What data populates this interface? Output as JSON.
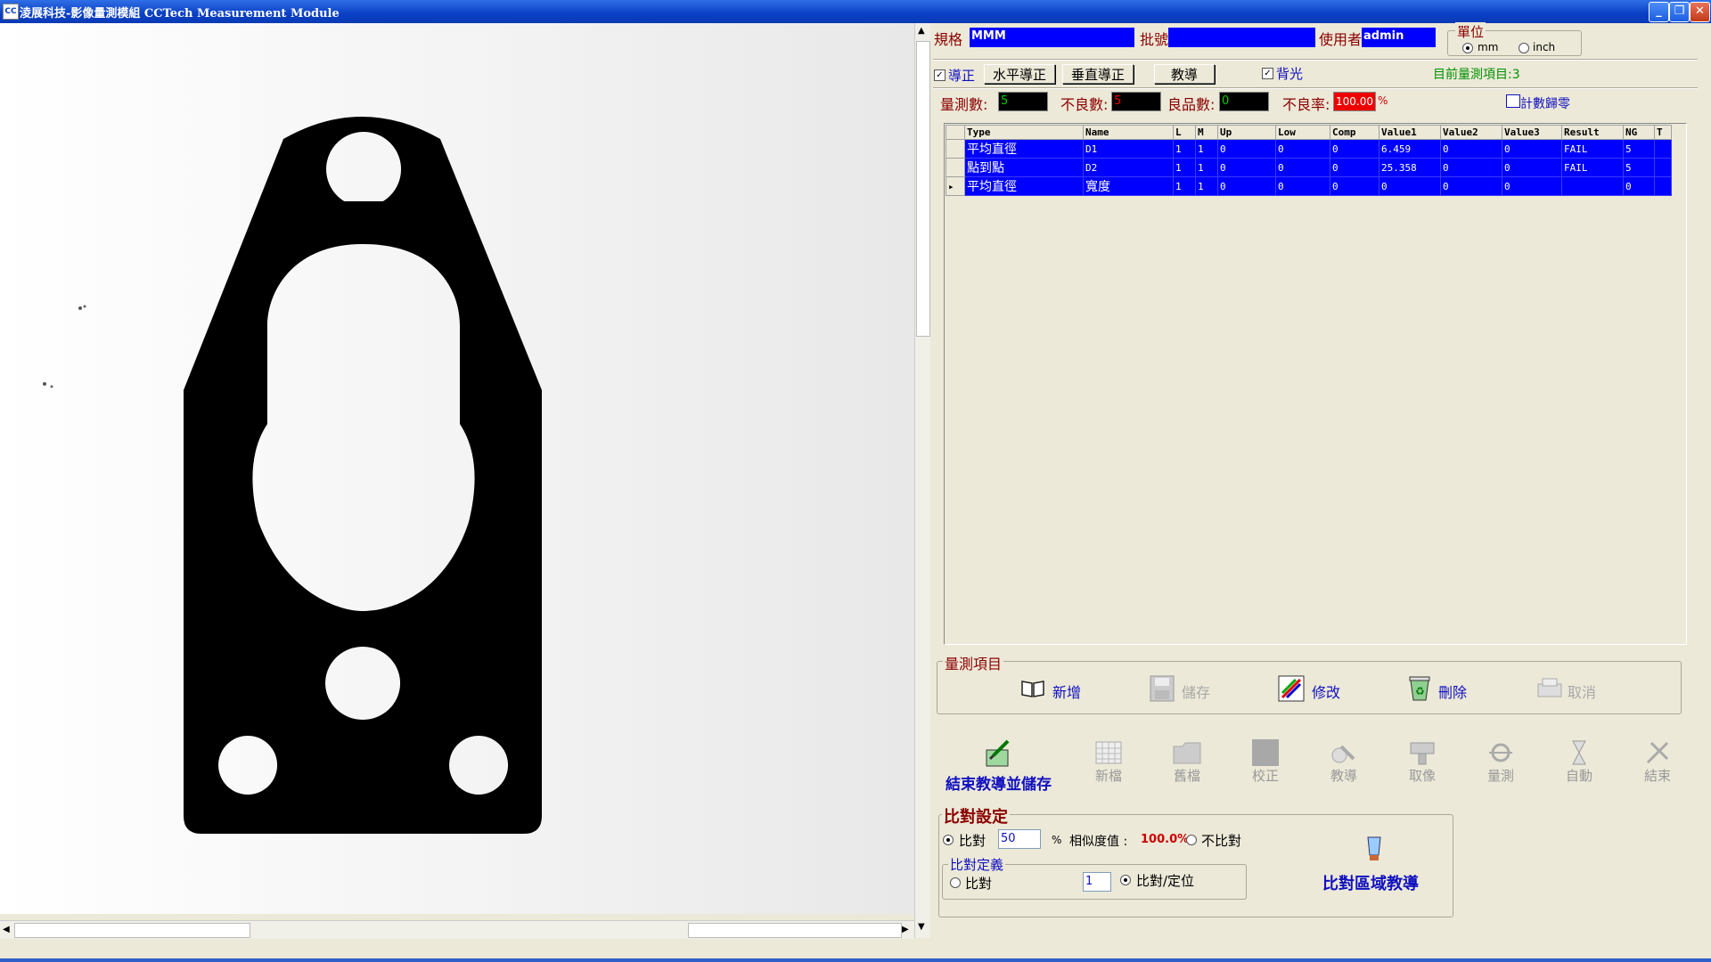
{
  "window": {
    "title": "淩展科技-影像量測模組 CCTech Measurement Module",
    "icon_text": "CC"
  },
  "header": {
    "spec_label": "規格",
    "spec_value": "MMM",
    "batch_label": "批號",
    "batch_value": "",
    "user_label": "使用者",
    "user_value": "admin",
    "unit_label": "單位",
    "unit_mm": "mm",
    "unit_inch": "inch",
    "unit_selected": "mm"
  },
  "toolbar": {
    "align_label": "導正",
    "align_checked": true,
    "h_align_button": "水平導正",
    "v_align_button": "垂直導正",
    "teach_button": "教導",
    "backlight_label": "背光",
    "backlight_checked": true,
    "current_items": "目前量測項目:3"
  },
  "counters": {
    "measure_label": "量測數:",
    "measure_value": "5",
    "bad_label": "不良數:",
    "bad_value": "5",
    "good_label": "良品數:",
    "good_value": "0",
    "bad_rate_label": "不良率:",
    "bad_rate_value": "100.00",
    "percent": "%",
    "reset_label": "計數歸零"
  },
  "grid": {
    "columns": [
      "Type",
      "Name",
      "L",
      "M",
      "Up",
      "Low",
      "Comp",
      "Value1",
      "Value2",
      "Value3",
      "Result",
      "NG",
      "T"
    ],
    "rows": [
      [
        "平均直徑",
        "D1",
        "1",
        "1",
        "0",
        "0",
        "0",
        "6.459",
        "0",
        "0",
        "FAIL",
        "5",
        ""
      ],
      [
        "點到點",
        "D2",
        "1",
        "1",
        "0",
        "0",
        "0",
        "25.358",
        "0",
        "0",
        "FAIL",
        "5",
        ""
      ],
      [
        "平均直徑",
        "寬度",
        "1",
        "1",
        "0",
        "0",
        "0",
        "0",
        "0",
        "0",
        "",
        "0",
        ""
      ]
    ]
  },
  "items_panel": {
    "title": "量測項目",
    "add": "新增",
    "save": "儲存",
    "modify": "修改",
    "delete": "刪除",
    "cancel": "取消"
  },
  "main_toolbar": {
    "end_teach_save": "結束教導並儲存",
    "new_file": "新檔",
    "old_file": "舊檔",
    "calibrate": "校正",
    "teach": "教導",
    "capture": "取像",
    "measure": "量測",
    "auto": "自動",
    "exit": "結束"
  },
  "compare": {
    "title": "比對設定",
    "compare_label": "比對",
    "compare_value": "50",
    "percent": "%",
    "similarity_label": "相似度值 :",
    "similarity_value": "100.0%",
    "no_compare_label": "不比對",
    "define_title": "比對定義",
    "define_compare": "比對",
    "define_value": "1",
    "define_compare_locate": "比對/定位",
    "region_teach": "比對區域教導"
  },
  "colors": {
    "accent_blue": "#0000ff",
    "label_red": "#8b0000",
    "link_blue": "#1010c0",
    "value_red": "#cc0000",
    "value_green": "#00cc00"
  }
}
